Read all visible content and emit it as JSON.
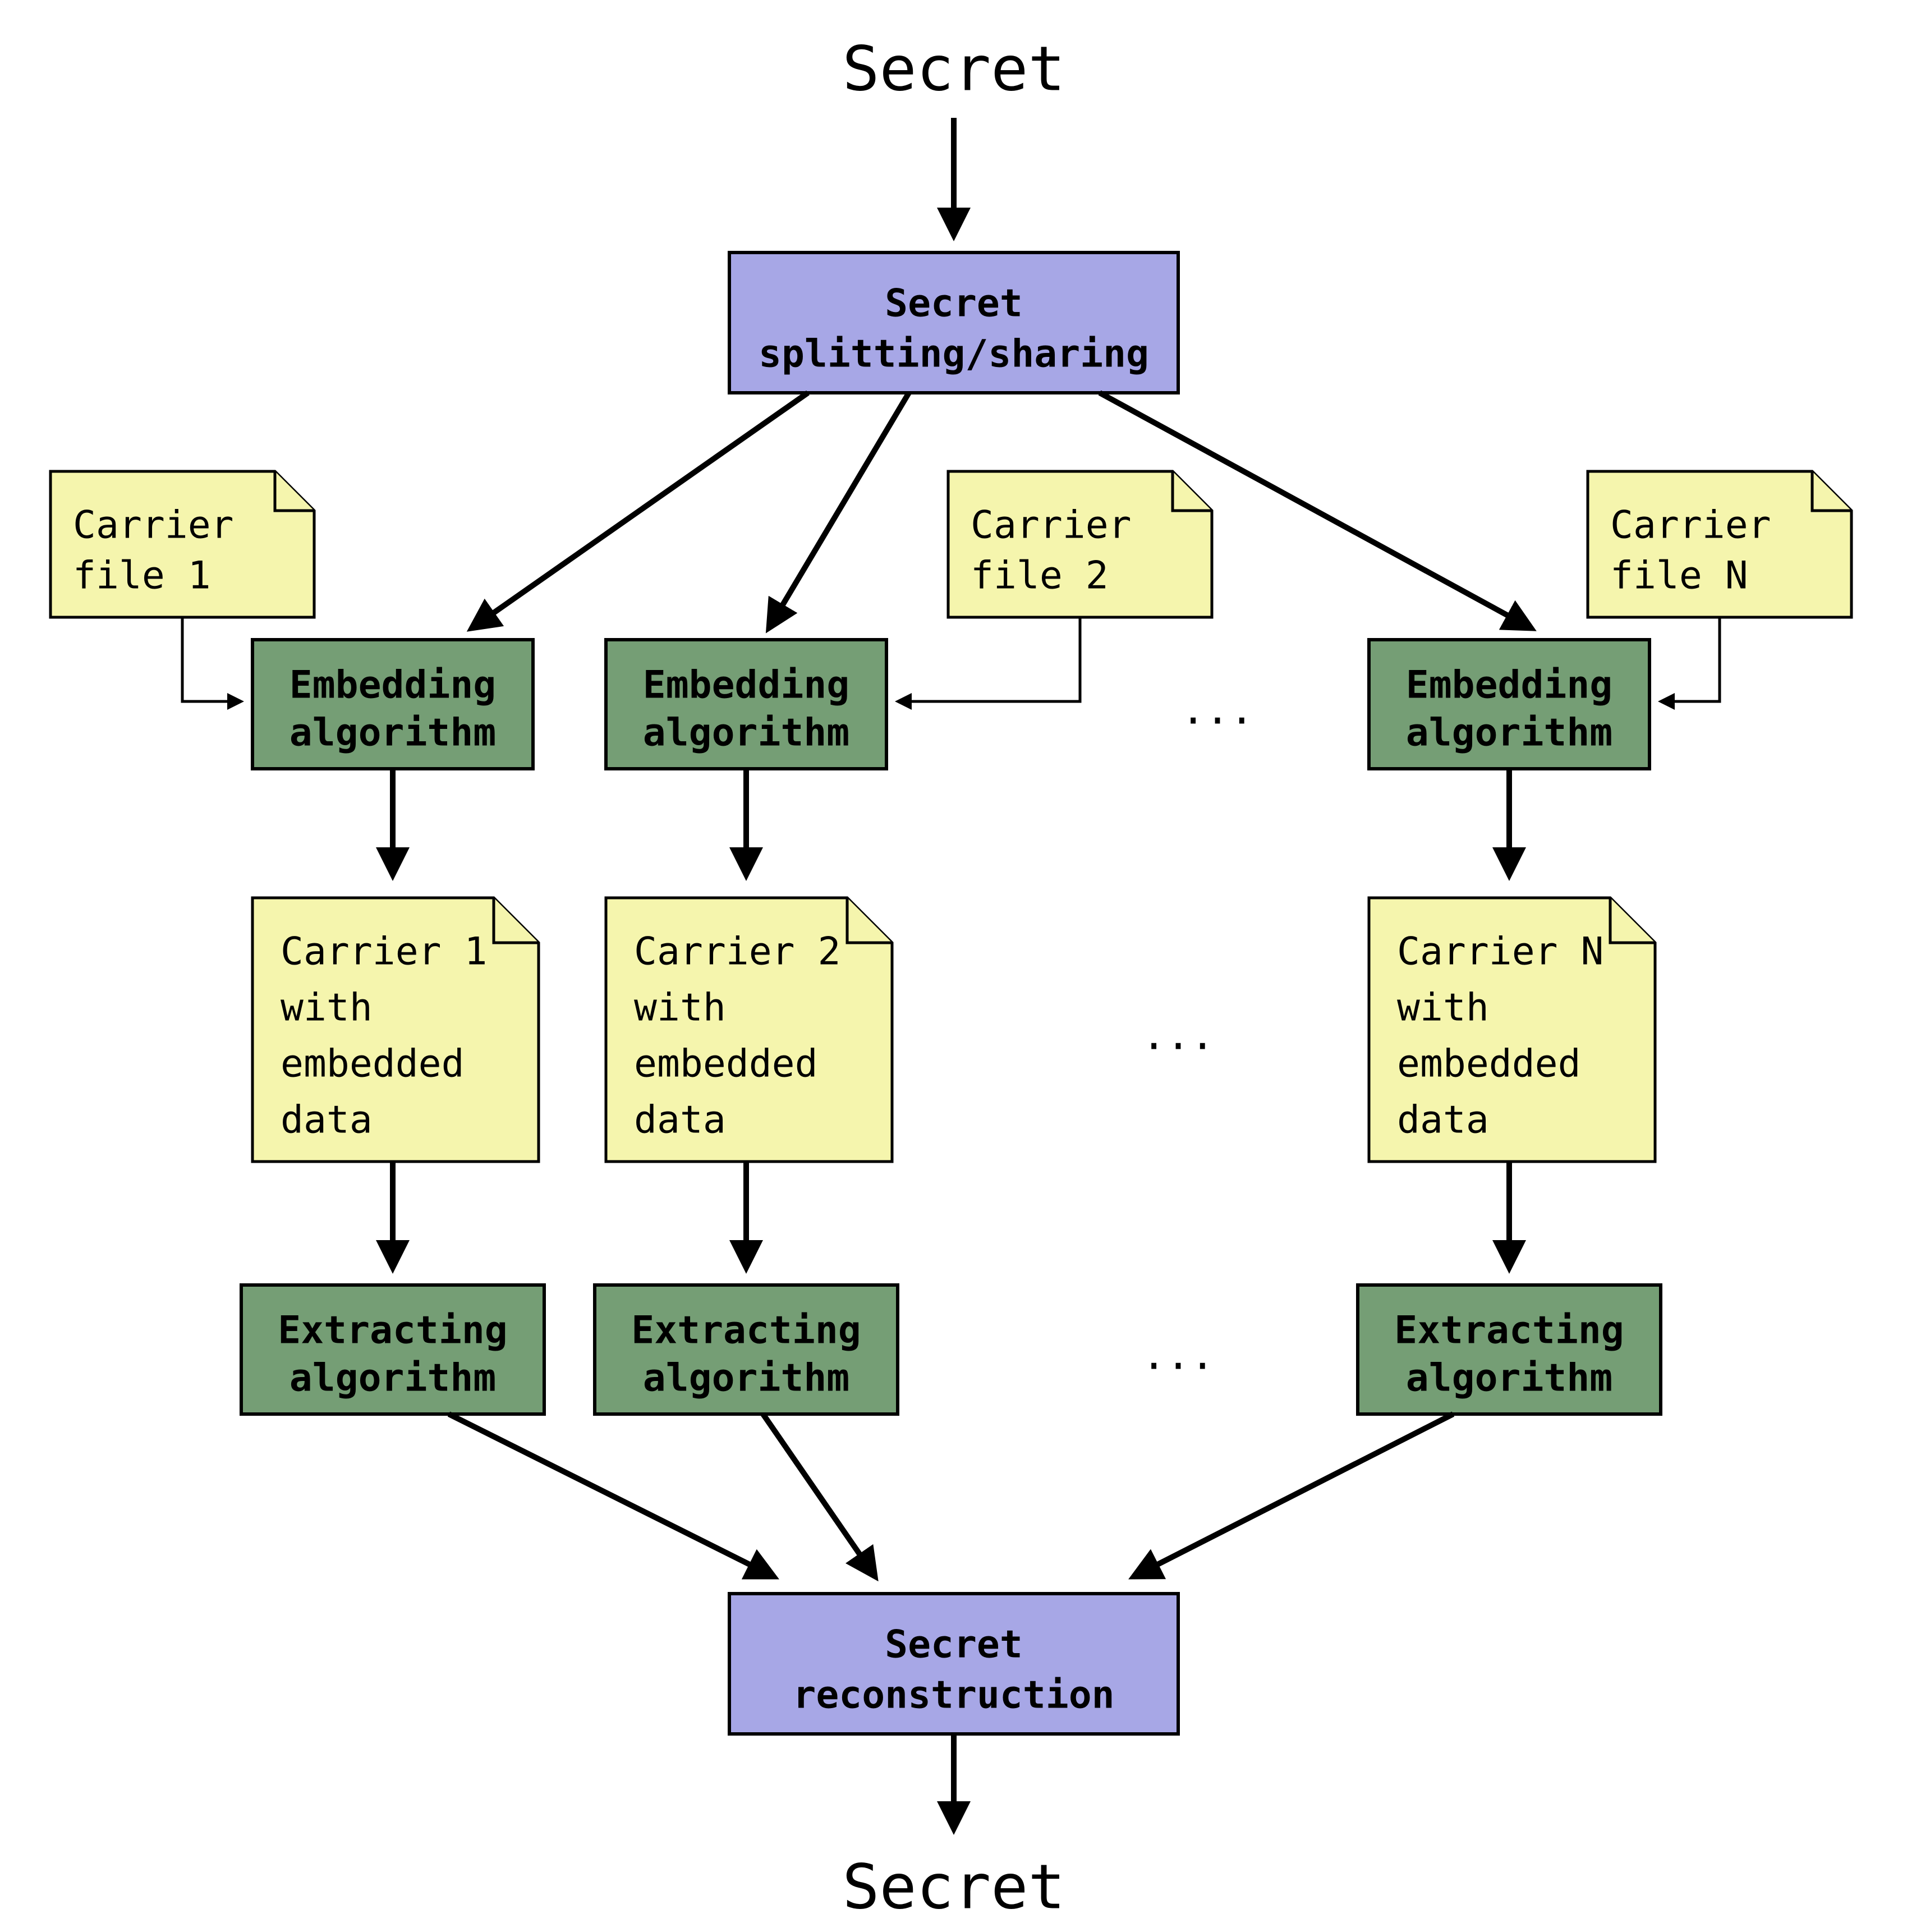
{
  "title_top": "Secret",
  "title_bottom": "Secret",
  "secret_split": {
    "line1": "Secret",
    "line2": "splitting/sharing"
  },
  "secret_recon": {
    "line1": "Secret",
    "line2": "reconstruction"
  },
  "embed": {
    "line1": "Embedding",
    "line2": "algorithm"
  },
  "extract": {
    "line1": "Extracting",
    "line2": "algorithm"
  },
  "carrier_in": {
    "c1": {
      "l1": "Carrier",
      "l2": "file 1"
    },
    "c2": {
      "l1": "Carrier",
      "l2": "file 2"
    },
    "cN": {
      "l1": "Carrier",
      "l2": "file N"
    }
  },
  "carrier_out": {
    "c1": {
      "l1": "Carrier 1",
      "l2": "with",
      "l3": "embedded",
      "l4": "data"
    },
    "c2": {
      "l1": "Carrier 2",
      "l2": "with",
      "l3": "embedded",
      "l4": "data"
    },
    "cN": {
      "l1": "Carrier N",
      "l2": "with",
      "l3": "embedded",
      "l4": "data"
    }
  },
  "dots": "..."
}
